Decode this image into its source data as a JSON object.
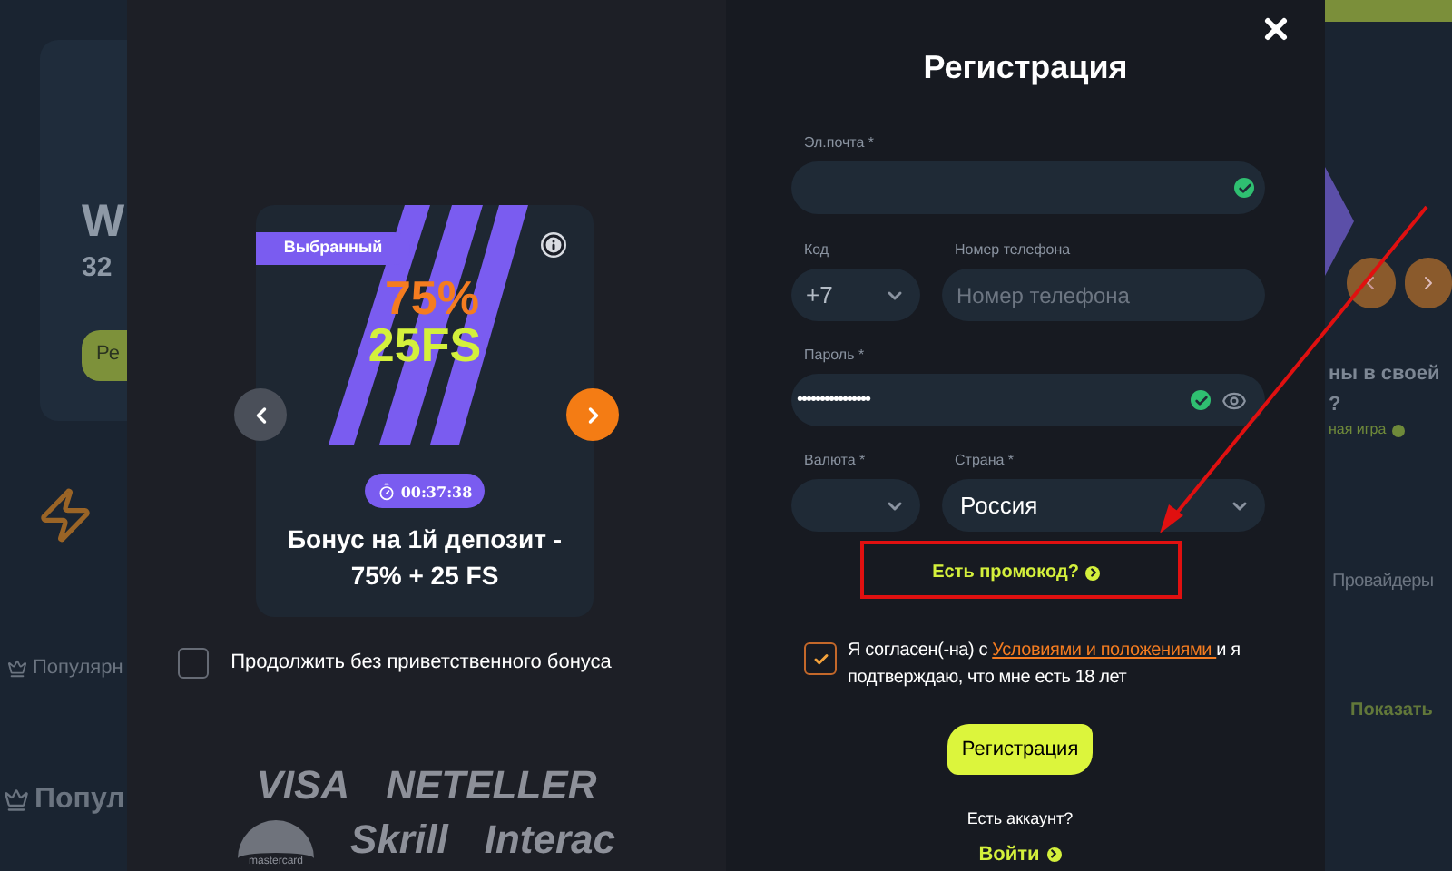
{
  "background": {
    "left_texts": {
      "title": "W",
      "subtitle": "32",
      "button": "Ре",
      "section_1": "Популярн",
      "section_2": "Попул"
    },
    "right_texts": {
      "line_1": "ны в своей",
      "line_2": "?",
      "link": "ная игра",
      "section": "Провайдеры",
      "show_more": "Показать"
    }
  },
  "bonus": {
    "badge": "Выбранный",
    "percent": "75%",
    "spins": "25FS",
    "timer": "00:37:38",
    "title": "Бонус на 1й депозит - 75% + 25 FS",
    "skip_bonus": {
      "label": "Продолжить без приветственного бонуса",
      "checked": false
    }
  },
  "payment_logos": [
    "VISA",
    "NETELLER",
    "mastercard",
    "Skrill",
    "Interac"
  ],
  "form": {
    "title": "Регистрация",
    "email": {
      "label": "Эл.почта *",
      "valid": true
    },
    "code": {
      "label": "Код",
      "value": "+7"
    },
    "phone": {
      "label": "Номер телефона",
      "placeholder": "Номер телефона"
    },
    "password": {
      "label": "Пароль *",
      "value": "••••••••••••••••",
      "valid": true
    },
    "currency": {
      "label": "Валюта *"
    },
    "country": {
      "label": "Страна *",
      "value": "Россия"
    },
    "promo_link": "Есть промокод?",
    "consent": {
      "checked": true,
      "before": "Я согласен(-на) с ",
      "link": "Условиями и положениями ",
      "after": "и я подтверждаю, что мне есть 18 лет"
    },
    "submit": "Регистрация",
    "have_account": "Есть аккаунт?",
    "login_link": "Войти"
  }
}
